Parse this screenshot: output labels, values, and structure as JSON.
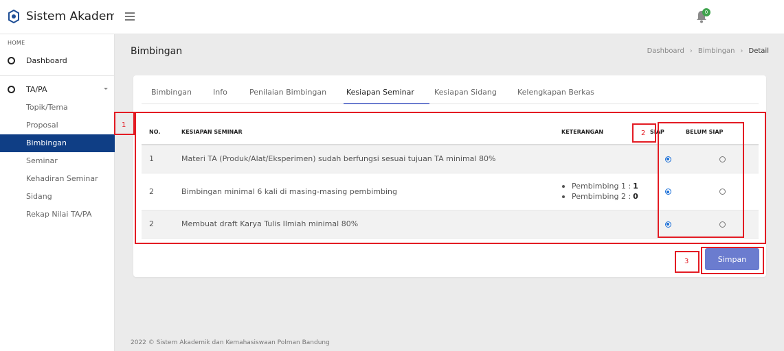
{
  "app": {
    "title": "Sistem Akademik"
  },
  "header": {
    "notification_count": "0"
  },
  "sidebar": {
    "section": "HOME",
    "dashboard": "Dashboard",
    "group": "TA/PA",
    "items": [
      {
        "label": "Topik/Tema",
        "active": false
      },
      {
        "label": "Proposal",
        "active": false
      },
      {
        "label": "Bimbingan",
        "active": true
      },
      {
        "label": "Seminar",
        "active": false
      },
      {
        "label": "Kehadiran Seminar",
        "active": false
      },
      {
        "label": "Sidang",
        "active": false
      },
      {
        "label": "Rekap Nilai TA/PA",
        "active": false
      }
    ]
  },
  "page": {
    "title": "Bimbingan",
    "breadcrumb": [
      "Dashboard",
      "Bimbingan",
      "Detail"
    ]
  },
  "tabs": [
    {
      "label": "Bimbingan",
      "active": false
    },
    {
      "label": "Info",
      "active": false
    },
    {
      "label": "Penilaian Bimbingan",
      "active": false
    },
    {
      "label": "Kesiapan Seminar",
      "active": true
    },
    {
      "label": "Kesiapan Sidang",
      "active": false
    },
    {
      "label": "Kelengkapan Berkas",
      "active": false
    }
  ],
  "table": {
    "headers": {
      "no": "NO.",
      "kesiapan": "KESIAPAN SEMINAR",
      "keterangan": "KETERANGAN",
      "siap": "SIAP",
      "belum_siap": "BELUM SIAP"
    },
    "rows": [
      {
        "no": "1",
        "kesiapan": "Materi TA (Produk/Alat/Eksperimen) sudah berfungsi sesuai tujuan TA minimal 80%",
        "status": "siap"
      },
      {
        "no": "2",
        "kesiapan": "Bimbingan minimal 6 kali di masing-masing pembimbing",
        "status": "siap",
        "keterangan": [
          {
            "label": "Pembimbing 1 :",
            "value": "1"
          },
          {
            "label": "Pembimbing 2 :",
            "value": "0"
          }
        ]
      },
      {
        "no": "2",
        "kesiapan": "Membuat draft Karya Tulis Ilmiah minimal 80%",
        "status": "siap"
      }
    ]
  },
  "actions": {
    "save": "Simpan"
  },
  "annotations": {
    "box1": "1",
    "box2": "2",
    "box3": "3",
    "color": "#e31b23"
  },
  "footer": {
    "text": "2022 © Sistem Akademik dan Kemahasiswaan Polman Bandung"
  },
  "colors": {
    "primary": "#6b7ccf",
    "sidebar_active": "#0f3e85",
    "badge": "#3fa34d"
  }
}
